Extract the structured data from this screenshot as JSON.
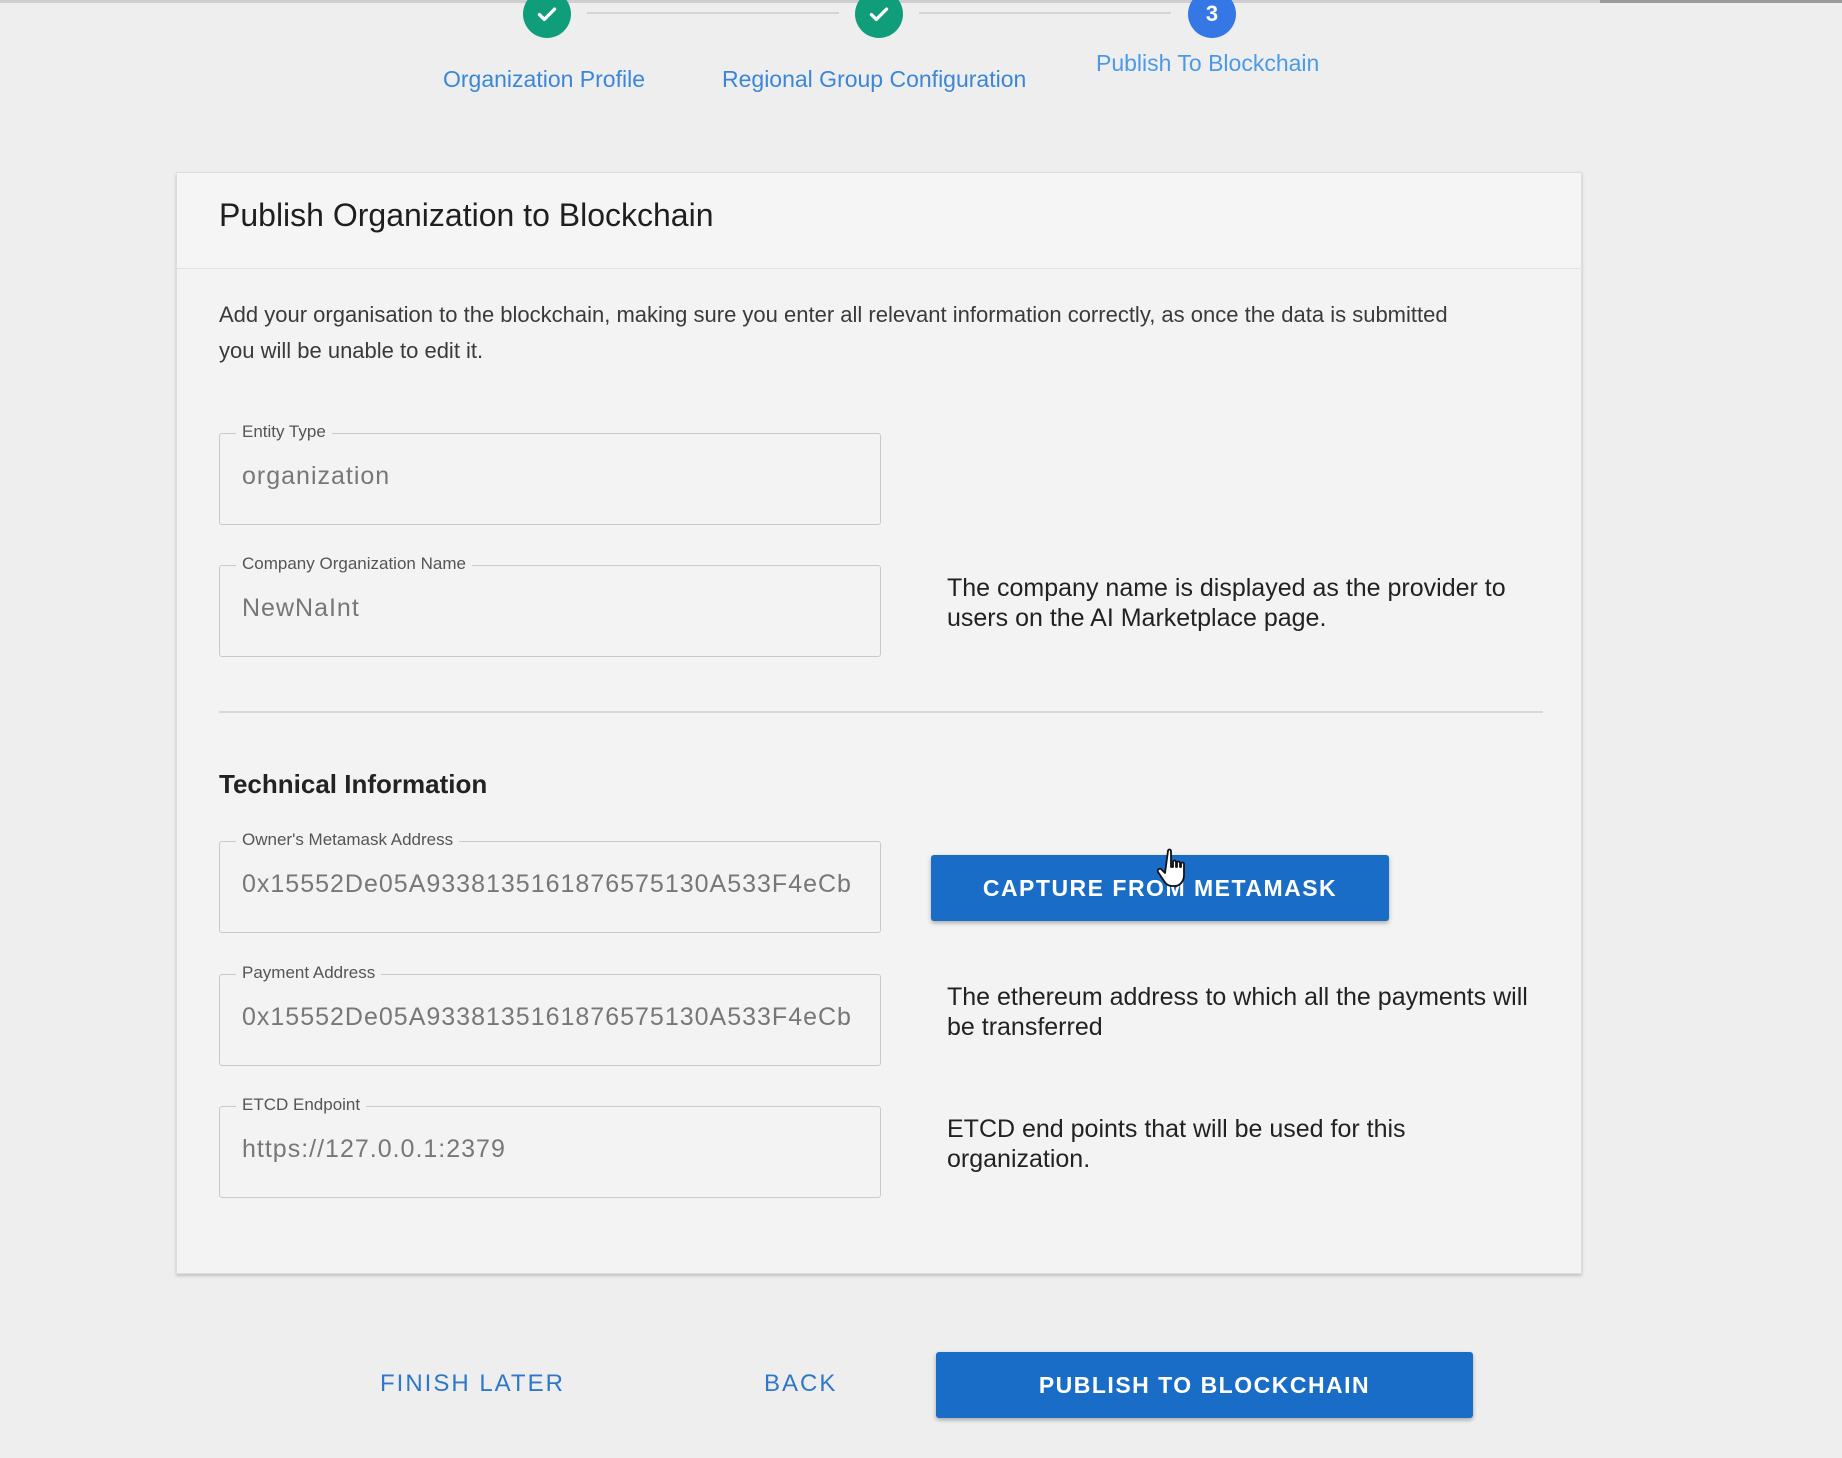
{
  "stepper": {
    "steps": [
      {
        "label": "Organization Profile",
        "status": "done"
      },
      {
        "label": "Regional Group Configuration",
        "status": "done"
      },
      {
        "label": "Publish To Blockchain",
        "status": "active",
        "number": "3"
      }
    ]
  },
  "card": {
    "title": "Publish Organization to Blockchain",
    "description": "Add your organisation to the blockchain, making sure you enter all relevant information correctly, as once the data is submitted you will be unable to edit it.",
    "fields": {
      "entity_type": {
        "label": "Entity Type",
        "value": "organization"
      },
      "company_name": {
        "label": "Company Organization Name",
        "value": "NewNaInt"
      },
      "owner_address": {
        "label": "Owner's Metamask Address",
        "value": "0x15552De05A93381351618765751​30A533F4eCb"
      },
      "payment_address": {
        "label": "Payment Address",
        "value": "0x15552De05A9338135161876575130A533F4eCb"
      },
      "etcd_endpoint": {
        "label": "ETCD Endpoint",
        "value": "https://127.0.0.1:2379"
      }
    },
    "help": {
      "company_name": "The company name is displayed as the provider to users on the AI Marketplace page.",
      "payment_address": "The ethereum address to which all the payments will be transferred",
      "etcd_endpoint": "ETCD end points that will be used for this organization."
    },
    "technical_title": "Technical Information",
    "capture_button": "CAPTURE FROM METAMASK"
  },
  "footer": {
    "finish_later": "FINISH LATER",
    "back": "BACK",
    "publish": "PUBLISH TO BLOCKCHAIN"
  },
  "colors": {
    "done": "#0f9d7a",
    "active": "#3578e5",
    "primary_button": "#1a6dc7",
    "link": "#2f78c9"
  }
}
